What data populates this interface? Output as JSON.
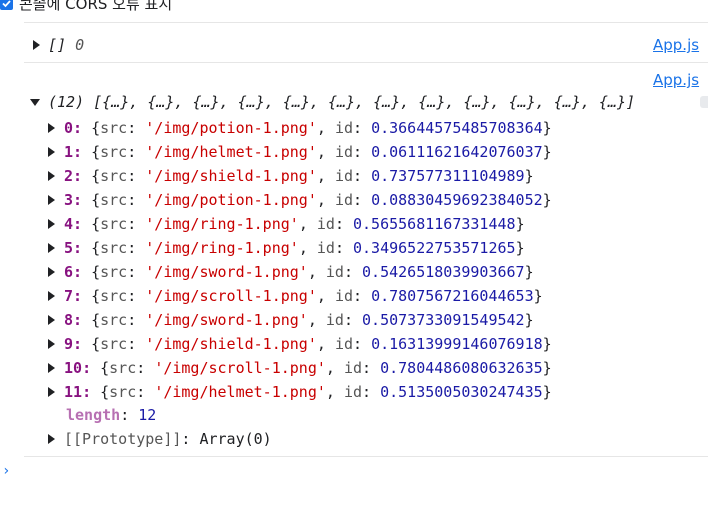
{
  "settings": {
    "cors_checkbox_label": "콘솔에 CORS 오류 표시",
    "cors_checkbox_checked": true
  },
  "logs": [
    {
      "summary_open": "[]",
      "summary_value": "0",
      "source": "App.js"
    },
    {
      "source": "App.js",
      "array_count": "(12)",
      "array_preview": "[{…}, {…}, {…}, {…}, {…}, {…}, {…}, {…}, {…}, {…}, {…}, {…}]",
      "items": [
        {
          "index": "0",
          "src": "'/img/potion-1.png'",
          "id": "0.36644575485708364"
        },
        {
          "index": "1",
          "src": "'/img/helmet-1.png'",
          "id": "0.06111621642076037"
        },
        {
          "index": "2",
          "src": "'/img/shield-1.png'",
          "id": "0.737577311104989"
        },
        {
          "index": "3",
          "src": "'/img/potion-1.png'",
          "id": "0.08830459692384052"
        },
        {
          "index": "4",
          "src": "'/img/ring-1.png'",
          "id": "0.5655681167331448"
        },
        {
          "index": "5",
          "src": "'/img/ring-1.png'",
          "id": "0.3496522753571265"
        },
        {
          "index": "6",
          "src": "'/img/sword-1.png'",
          "id": "0.5426518039903667"
        },
        {
          "index": "7",
          "src": "'/img/scroll-1.png'",
          "id": "0.7807567216044653"
        },
        {
          "index": "8",
          "src": "'/img/sword-1.png'",
          "id": "0.5073733091549542"
        },
        {
          "index": "9",
          "src": "'/img/shield-1.png'",
          "id": "0.16313999146076918"
        },
        {
          "index": "10",
          "src": "'/img/scroll-1.png'",
          "id": "0.7804486080632635"
        },
        {
          "index": "11",
          "src": "'/img/helmet-1.png'",
          "id": "0.5135005030247435"
        }
      ],
      "length_label": "length",
      "length_value": "12",
      "prototype_label": "[[Prototype]]",
      "prototype_value": "Array(0)"
    }
  ],
  "labels": {
    "src_key": "src",
    "id_key": "id"
  },
  "prompt_symbol": "›"
}
